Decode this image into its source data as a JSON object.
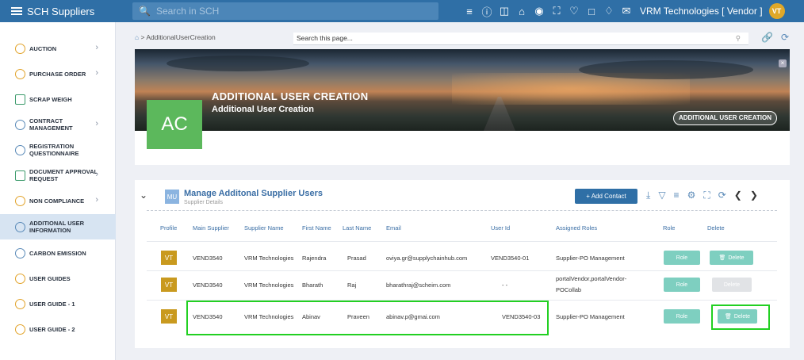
{
  "topbar": {
    "brand": "SCH Suppliers",
    "search_placeholder": "Search in SCH",
    "company": "VRM Technologies  [ Vendor ]",
    "avatar": "VT",
    "icons": [
      "list-icon",
      "help-icon",
      "clipboard-icon",
      "home-icon",
      "palette-icon",
      "expand-icon",
      "heart-icon",
      "chat-icon",
      "bell-icon",
      "mail-icon"
    ]
  },
  "sidebar": {
    "items": [
      {
        "label": "AUCTION",
        "chevron": true
      },
      {
        "label": "PURCHASE ORDER",
        "chevron": true
      },
      {
        "label": "SCRAP WEIGH",
        "chevron": false
      },
      {
        "label": "CONTRACT\nMANAGEMENT",
        "chevron": true
      },
      {
        "label": "REGISTRATION\nQUESTIONNAIRE",
        "chevron": false
      },
      {
        "label": "DOCUMENT APPROVAL\nREQUEST",
        "chevron": true
      },
      {
        "label": "NON COMPLIANCE",
        "chevron": true
      },
      {
        "label": "ADDITIONAL USER\nINFORMATION",
        "chevron": false,
        "active": true
      },
      {
        "label": "CARBON EMISSION",
        "chevron": false
      },
      {
        "label": "USER GUIDES",
        "chevron": false
      },
      {
        "label": "USER GUIDE - 1",
        "chevron": false
      },
      {
        "label": "USER GUIDE - 2",
        "chevron": false
      }
    ]
  },
  "breadcrumb": {
    "text": "AdditionalUserCreation",
    "search_placeholder": "Search this page..."
  },
  "banner": {
    "initials": "AC",
    "title": "ADDITIONAL USER CREATION",
    "subtitle": "Additional User Creation",
    "pill": "ADDITIONAL USER CREATION"
  },
  "users": {
    "badge": "MU",
    "title": "Manage Additonal Supplier Users",
    "subtitle": "Supplier Details",
    "add_contact": "+ Add Contact",
    "headers": {
      "profile": "Profile",
      "main_supplier": "Main Supplier",
      "supplier_name": "Supplier Name",
      "first_name": "First Name",
      "last_name": "Last Name",
      "email": "Email",
      "user_id": "User Id",
      "assigned_roles": "Assigned Roles",
      "role": "Role",
      "delete": "Delete"
    },
    "rows": [
      {
        "avatar": "VT",
        "main_supplier": "VEND3540",
        "supplier_name": "VRM Technologies",
        "first_name": "Rajendra",
        "last_name": "Prasad",
        "email": "oviya.gr@supplychainhub.com",
        "user_id": "VEND3540-01",
        "roles": "Supplier-PO Management",
        "role_btn": "Role",
        "delete_btn": "Delete",
        "delete_enabled": true
      },
      {
        "avatar": "VT",
        "main_supplier": "VEND3540",
        "supplier_name": "VRM Technologies",
        "first_name": "Bharath",
        "last_name": "Raj",
        "email": "bharathraj@scheim.com",
        "user_id": "- -",
        "roles": "portalVendor,portalVendor-POCollab",
        "role_btn": "Role",
        "delete_btn": "Delete",
        "delete_enabled": false
      },
      {
        "avatar": "VT",
        "main_supplier": "VEND3540",
        "supplier_name": "VRM Technologies",
        "first_name": "Abinav",
        "last_name": "Praveen",
        "email": "abinav.p@gmai.com",
        "user_id": "VEND3540-03",
        "roles": "Supplier-PO Management",
        "role_btn": "Role",
        "delete_btn": "Delete",
        "delete_enabled": true
      }
    ]
  },
  "colors": {
    "topbar": "#2f6fa6",
    "accent_green": "#5cb85c",
    "role_button": "#7ecfc0",
    "highlight": "#22d022",
    "avatar": "#c99a1f"
  }
}
